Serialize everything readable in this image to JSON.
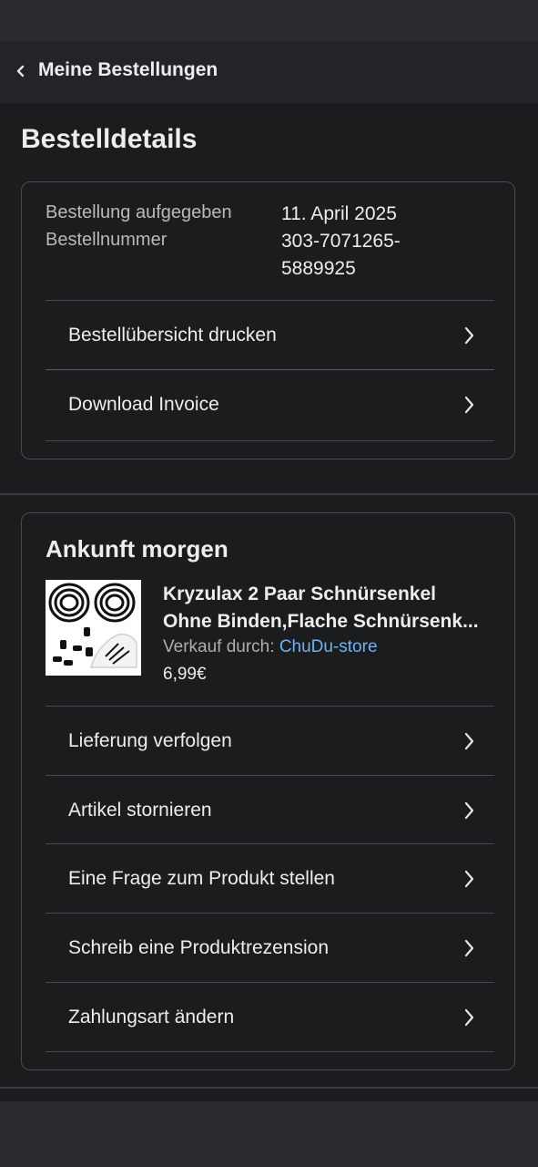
{
  "header": {
    "back_label": "Meine Bestellungen"
  },
  "page_title": "Bestelldetails",
  "order_info": {
    "placed_label": "Bestellung aufgegeben",
    "placed_value": "11. April 2025",
    "number_label": "Bestellnummer",
    "number_value_line1": "303-7071265-",
    "number_value_line2": "5889925"
  },
  "order_actions": [
    {
      "label": "Bestellübersicht drucken"
    },
    {
      "label": "Download Invoice"
    }
  ],
  "shipment": {
    "title": "Ankunft morgen",
    "product": {
      "name_line1": "Kryzulax 2 Paar Schnürsenkel",
      "name_line2": "Ohne Binden,Flache Schnürsenk...",
      "seller_prefix": "Verkauf durch:",
      "seller_name": "ChuDu-store",
      "price": "6,99€"
    },
    "actions": [
      {
        "label": "Lieferung verfolgen"
      },
      {
        "label": "Artikel stornieren"
      },
      {
        "label": "Eine Frage zum Produkt stellen"
      },
      {
        "label": "Schreib eine Produktrezension"
      },
      {
        "label": "Zahlungsart ändern"
      }
    ]
  },
  "colors": {
    "background": "#1b1c1e",
    "link": "#6cb2f5"
  }
}
